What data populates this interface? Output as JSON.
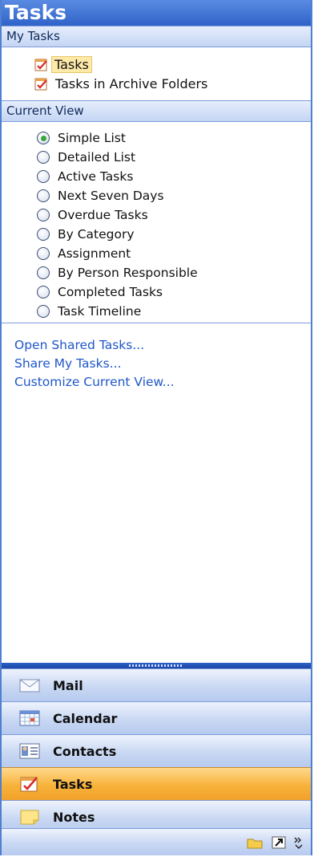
{
  "window": {
    "title": "Tasks"
  },
  "my_tasks": {
    "header": "My Tasks",
    "items": [
      {
        "label": "Tasks",
        "icon": "task-clipboard-icon",
        "selected": true
      },
      {
        "label": "Tasks in Archive Folders",
        "icon": "task-clipboard-icon",
        "selected": false
      }
    ]
  },
  "current_view": {
    "header": "Current View",
    "options": [
      {
        "label": "Simple List",
        "selected": true
      },
      {
        "label": "Detailed List",
        "selected": false
      },
      {
        "label": "Active Tasks",
        "selected": false
      },
      {
        "label": "Next Seven Days",
        "selected": false
      },
      {
        "label": "Overdue Tasks",
        "selected": false
      },
      {
        "label": "By Category",
        "selected": false
      },
      {
        "label": "Assignment",
        "selected": false
      },
      {
        "label": "By Person Responsible",
        "selected": false
      },
      {
        "label": "Completed Tasks",
        "selected": false
      },
      {
        "label": "Task Timeline",
        "selected": false
      }
    ]
  },
  "links": [
    {
      "label": "Open Shared Tasks..."
    },
    {
      "label": "Share My Tasks..."
    },
    {
      "label": "Customize Current View..."
    }
  ],
  "navigation": {
    "buttons": [
      {
        "label": "Mail",
        "icon": "mail-envelope-icon",
        "active": false
      },
      {
        "label": "Calendar",
        "icon": "calendar-icon",
        "active": false
      },
      {
        "label": "Contacts",
        "icon": "contacts-card-icon",
        "active": false
      },
      {
        "label": "Tasks",
        "icon": "task-clipboard-icon",
        "active": true
      },
      {
        "label": "Notes",
        "icon": "sticky-note-icon",
        "active": false
      }
    ],
    "bottom_icons": [
      "folder-icon",
      "shortcut-icon",
      "configure-buttons-icon"
    ]
  },
  "colors": {
    "accent": "#2f63c8",
    "active_nav": "#f7b23a",
    "link": "#1f57c8",
    "selection": "#fde9a8"
  }
}
